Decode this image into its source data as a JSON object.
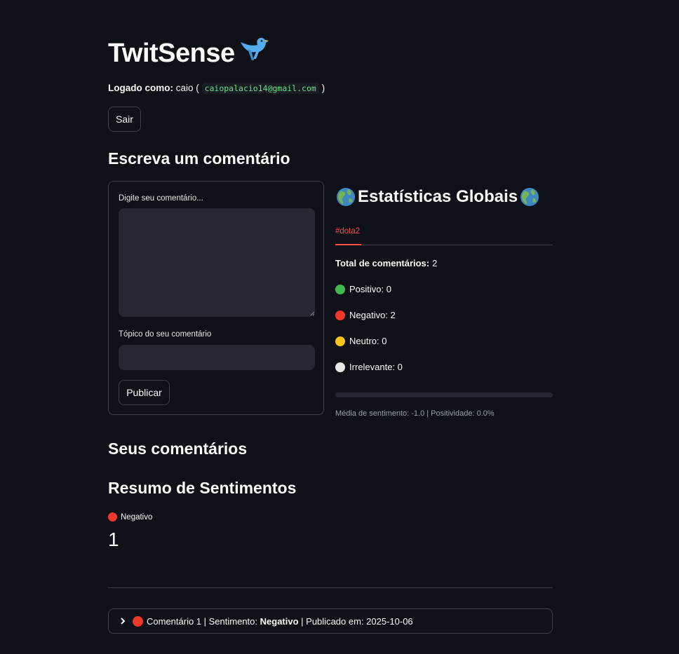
{
  "app": {
    "title": "TwitSense",
    "title_icon": "bird-icon"
  },
  "user": {
    "prefix": "Logado como:",
    "name": "caio",
    "open_paren": "(",
    "email": "caiopalacio14@gmail.com",
    "close_paren": ")"
  },
  "logout_label": "Sair",
  "compose": {
    "heading": "Escreva um comentário",
    "comment_label": "Digite seu comentário...",
    "comment_value": "",
    "topic_label": "Tópico do seu comentário",
    "topic_value": "",
    "submit_label": "Publicar"
  },
  "stats": {
    "title": "Estatísticas Globais",
    "title_icon": "globe-icon",
    "tabs": [
      {
        "label": "#dota2",
        "active": true
      }
    ],
    "total_label": "Total de comentários:",
    "total_value": "2",
    "items": [
      {
        "text": "Positivo: 0",
        "color": "#3fb950",
        "icon": "green-circle-icon"
      },
      {
        "text": "Negativo: 2",
        "color": "#f0372e",
        "icon": "red-circle-icon"
      },
      {
        "text": "Neutro: 0",
        "color": "#f5c518",
        "icon": "yellow-circle-icon"
      },
      {
        "text": "Irrelevante: 0",
        "color": "#e8e8e8",
        "icon": "white-circle-icon"
      }
    ],
    "positivity_progress": 0.0,
    "caption": "Média de sentimento: -1.0 | Positividade: 0.0%"
  },
  "my_comments": {
    "heading": "Seus comentários",
    "summary_heading": "Resumo de Sentimentos",
    "metric_label": "Negativo",
    "metric_value": "1"
  },
  "comments": [
    {
      "prefix": "Comentário 1 | Sentimento:",
      "sentiment": "Negativo",
      "suffix": "| Publicado em: 2025-10-06",
      "icon": "red-circle-icon"
    }
  ],
  "colors": {
    "background": "#0e1117",
    "accent": "#ff4b4b",
    "input_bg": "#262730",
    "border": "#3d4048",
    "code_text": "#5ce488"
  }
}
